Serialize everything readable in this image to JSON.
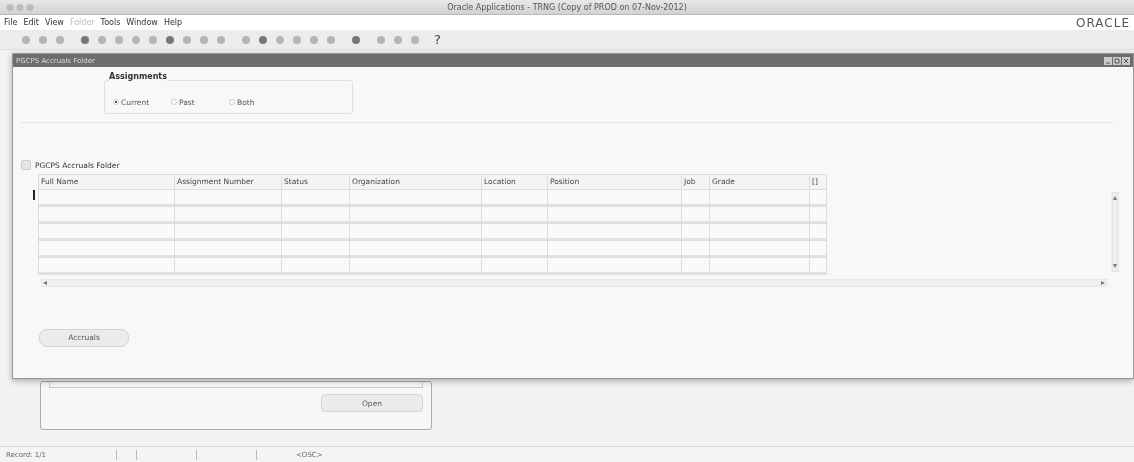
{
  "window": {
    "title": "Oracle Applications - TRNG (Copy of PROD on 07-Nov-2012)"
  },
  "menu": [
    {
      "label": "File",
      "disabled": false
    },
    {
      "label": "Edit",
      "disabled": false
    },
    {
      "label": "View",
      "disabled": false
    },
    {
      "label": "Folder",
      "disabled": true
    },
    {
      "label": "Tools",
      "disabled": false
    },
    {
      "label": "Window",
      "disabled": false
    },
    {
      "label": "Help",
      "disabled": false
    }
  ],
  "brand": "ORACLE",
  "toolbar": {
    "help_glyph": "?"
  },
  "form": {
    "title": "PGCPS Accruals Folder",
    "assignments": {
      "label": "Assignments",
      "options": [
        {
          "label": "Current",
          "selected": true
        },
        {
          "label": "Past",
          "selected": false
        },
        {
          "label": "Both",
          "selected": false
        }
      ]
    },
    "folder_checked": false,
    "folder_label": "PGCPS Accruals Folder",
    "table": {
      "columns": [
        "Full Name",
        "Assignment Number",
        "Status",
        "Organization",
        "Location",
        "Position",
        "Job",
        "Grade",
        "[]"
      ],
      "rows": [
        {
          "current": true
        },
        {
          "current": false
        },
        {
          "current": false
        },
        {
          "current": false
        },
        {
          "current": false
        }
      ]
    },
    "button": "Accruals"
  },
  "background_form": {
    "button": "Open"
  },
  "status_bar": {
    "record": "Record: 1/1",
    "mode": "<OSC>"
  }
}
